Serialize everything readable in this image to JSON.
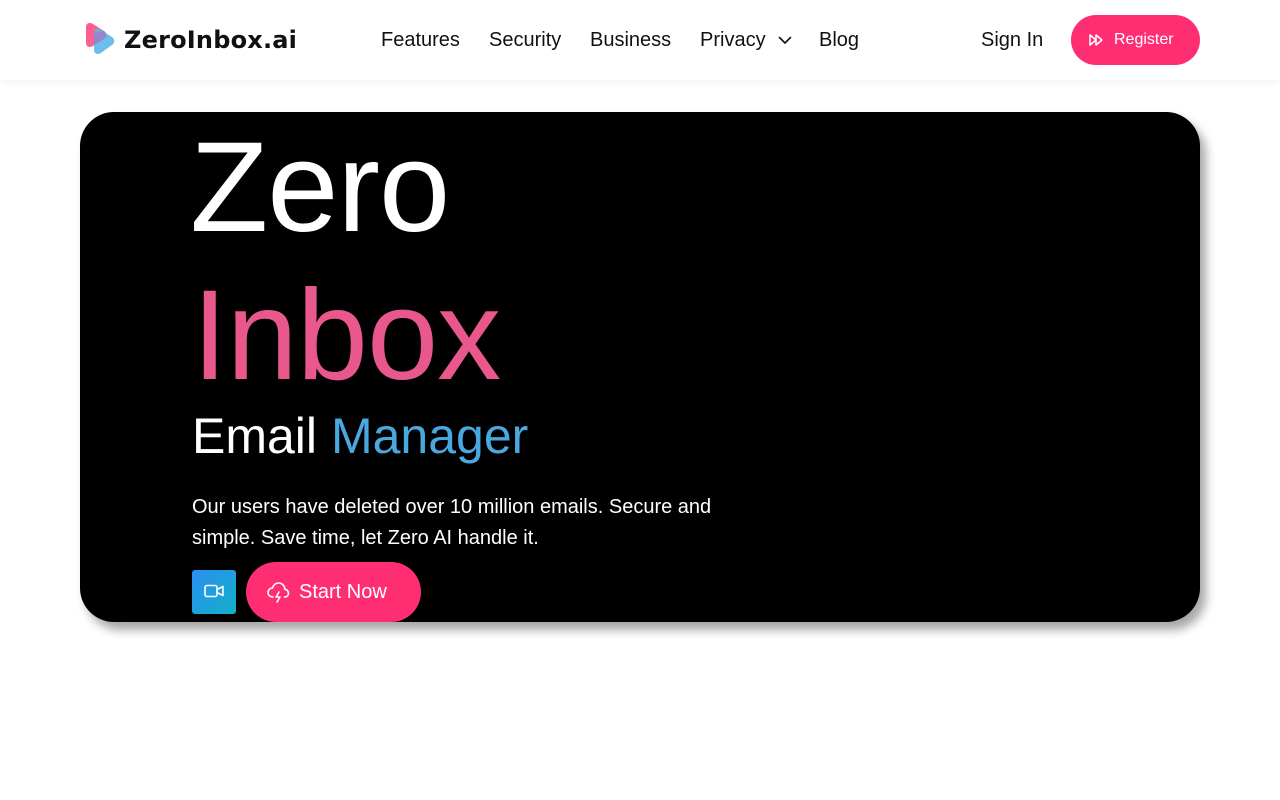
{
  "brand": {
    "name": "ZeroInbox.ai",
    "colors": {
      "accent_pink": "#ff2e73",
      "inbox_pink": "#e8588c",
      "manager_blue": "#4aa8e0",
      "hero_bg": "#000000"
    }
  },
  "nav": {
    "items": [
      {
        "label": "Features"
      },
      {
        "label": "Security"
      },
      {
        "label": "Business"
      },
      {
        "label": "Privacy",
        "icon": "chevron-down-icon"
      },
      {
        "label": "Blog"
      }
    ]
  },
  "auth": {
    "signin_label": "Sign In",
    "register_label": "Register",
    "register_icon": "fast-forward-icon"
  },
  "hero": {
    "title_line1": "Zero",
    "title_line2": "Inbox",
    "subtitle_plain": "Email",
    "subtitle_accent": "Manager",
    "description": "Our users have deleted over 10 million emails. Secure and simple. Save time, let Zero AI handle it.",
    "video_button_icon": "video-camera-icon",
    "cta_label": "Start Now",
    "cta_icon": "cloud-lightning-icon"
  }
}
